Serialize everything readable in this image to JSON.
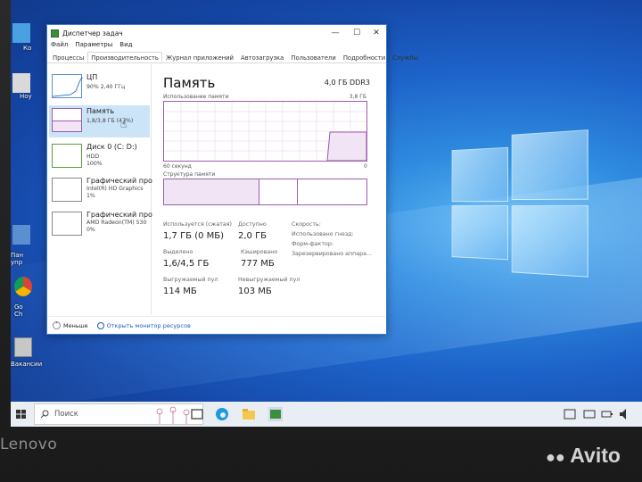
{
  "window": {
    "title": "Диспетчер задач",
    "controls": [
      "—",
      "☐",
      "✕"
    ]
  },
  "menu": [
    "Файл",
    "Параметры",
    "Вид"
  ],
  "tabs": [
    "Процессы",
    "Производительность",
    "Журнал приложений",
    "Автозагрузка",
    "Пользователи",
    "Подробности",
    "Службы"
  ],
  "active_tab": "Производительность",
  "sidebar": [
    {
      "name": "ЦП",
      "sub1": "90% 2,40 ГГц",
      "sub2": ""
    },
    {
      "name": "Память",
      "sub1": "1,8/3,8 ГБ (47%)",
      "sub2": ""
    },
    {
      "name": "Диск 0 (C: D:)",
      "sub1": "HDD",
      "sub2": "100%"
    },
    {
      "name": "Графический про",
      "sub1": "Intel(R) HD Graphics",
      "sub2": "1%"
    },
    {
      "name": "Графический про",
      "sub1": "AMD Radeon(TM) 530",
      "sub2": "0%"
    }
  ],
  "memory": {
    "title": "Память",
    "spec": "4,0 ГБ DDR3",
    "usage_label": "Использование памяти",
    "usage_max": "3,8 ГБ",
    "time_left": "60 секунд",
    "time_right": "0",
    "structure_label": "Структура памяти",
    "stats": {
      "in_use_label": "Используется (сжатая)",
      "in_use_value": "1,7 ГБ (0 МБ)",
      "available_label": "Доступно",
      "available_value": "2,0 ГБ",
      "committed_label": "Выделено",
      "committed_value": "1,6/4,5 ГБ",
      "cached_label": "Кэшировано",
      "cached_value": "777 МБ",
      "paged_label": "Выгружаемый пул",
      "paged_value": "114 МБ",
      "nonpaged_label": "Невыгружаемый пул",
      "nonpaged_value": "103 МБ",
      "speed_label": "Скорость:",
      "slots_label": "Использовано гнезд:",
      "form_label": "Форм-фактор:",
      "reserved_label": "Зарезервировано аппара..."
    }
  },
  "footer": {
    "less": "Меньше",
    "monitor": "Открыть монитор ресурсов"
  },
  "taskbar": {
    "search_placeholder": "Поиск"
  },
  "desktop_icons": [
    "Ко",
    "Ноу",
    "Пан упр",
    "Go Ch",
    "Вакансии"
  ],
  "bezel": {
    "brand": "Lenovo",
    "watermark": "Avito"
  }
}
